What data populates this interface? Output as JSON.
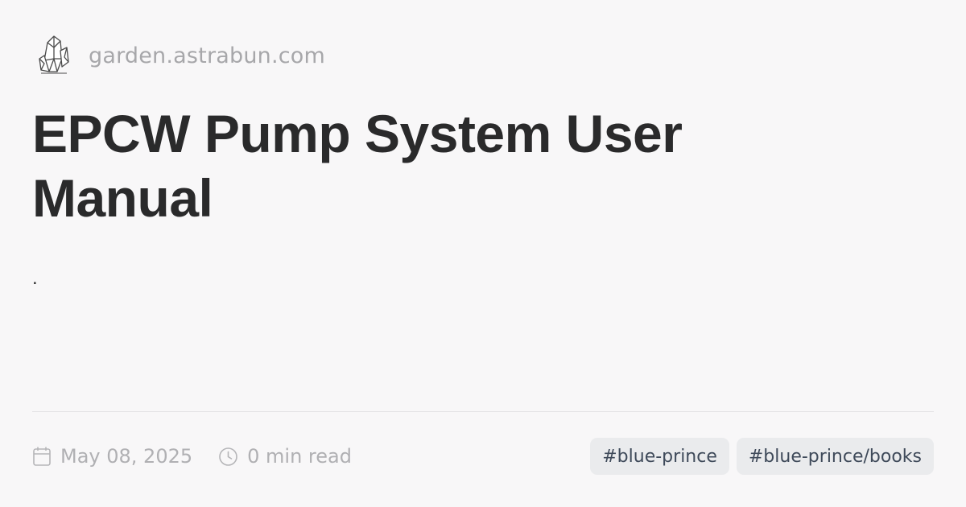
{
  "site": {
    "logo_icon": "crystal-icon",
    "domain": "garden.astrabun.com"
  },
  "post": {
    "title": "EPCW Pump System User Manual",
    "excerpt": ".",
    "date": "May 08, 2025",
    "reading_time": "0 min read",
    "date_icon": "calendar-icon",
    "time_icon": "clock-icon"
  },
  "tags": [
    "#blue-prince",
    "#blue-prince/books"
  ],
  "colors": {
    "background": "#f8f7f8",
    "title": "#2a2a2b",
    "muted": "#a7a7aa",
    "tag_bg": "#eaebed",
    "tag_text": "#3f4a5a"
  }
}
